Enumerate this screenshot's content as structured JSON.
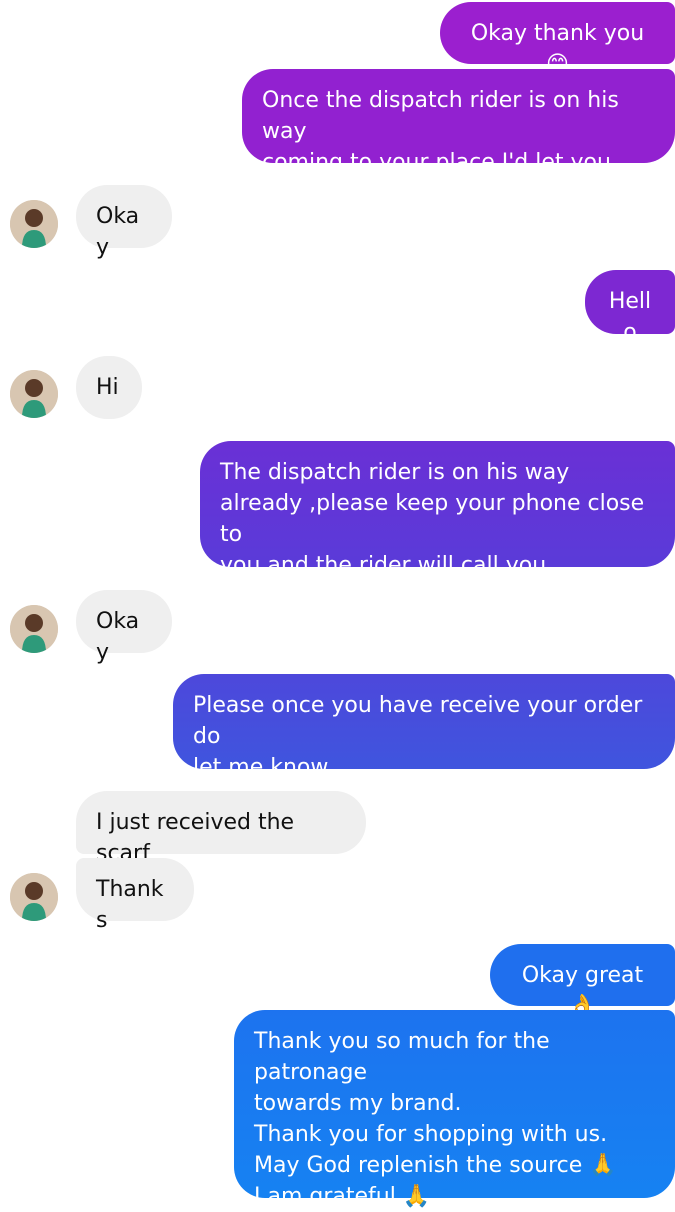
{
  "conversation": {
    "messages": [
      {
        "from": "me",
        "text": "Okay thank you 😊"
      },
      {
        "from": "me",
        "text": "Once the dispatch rider is on his way\ncoming to your place I'd let you know"
      },
      {
        "from": "them",
        "text": "Okay"
      },
      {
        "from": "me",
        "text": "Hello"
      },
      {
        "from": "them",
        "text": "Hi"
      },
      {
        "from": "me",
        "text": "The  dispatch rider is on his way\nalready ,please keep your phone close to\nyou and the rider will call you."
      },
      {
        "from": "them",
        "text": "Okay"
      },
      {
        "from": "me",
        "text": "Please once you have receive your order do\nlet me know."
      },
      {
        "from": "them",
        "text": "I just received the scarf"
      },
      {
        "from": "them",
        "text": "Thanks"
      },
      {
        "from": "me",
        "text": "Okay great 👌"
      },
      {
        "from": "me",
        "text": "Thank you so much for the patronage\ntowards my brand.\nThank you for shopping with us.\nMay God  replenish the source 🙏\nI am grateful 🙏"
      }
    ]
  },
  "colors": {
    "outgoing_gradient_top": "#9b1fcf",
    "outgoing_gradient_mid": "#5b3fd9",
    "outgoing_gradient_bottom": "#1878f0",
    "incoming_background": "#efefef"
  }
}
